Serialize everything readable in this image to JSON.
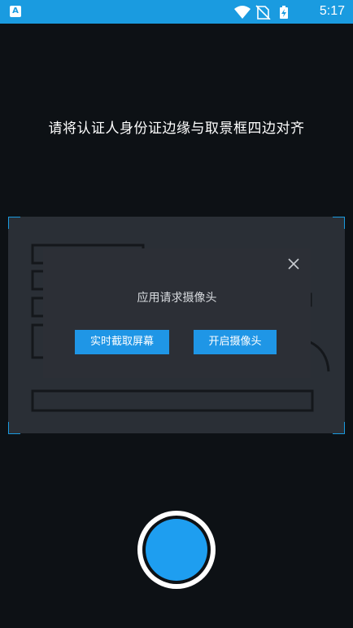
{
  "status_bar": {
    "app_badge": "A",
    "icons": [
      "wifi-icon",
      "no-sim-icon",
      "battery-charging-icon"
    ],
    "time": "5:17"
  },
  "instruction": "请将认证人身份证边缘与取景框四边对齐",
  "dialog": {
    "message": "应用请求摄像头",
    "close_icon": "close-icon",
    "buttons": {
      "screenshot": "实时截取屏幕",
      "open_camera": "开启摄像头"
    }
  },
  "shutter_icon": "shutter-button",
  "colors": {
    "accent": "#1f96e6",
    "status_bar": "#1a9be0",
    "background": "#0d1115",
    "dialog": "#2c2f36"
  }
}
